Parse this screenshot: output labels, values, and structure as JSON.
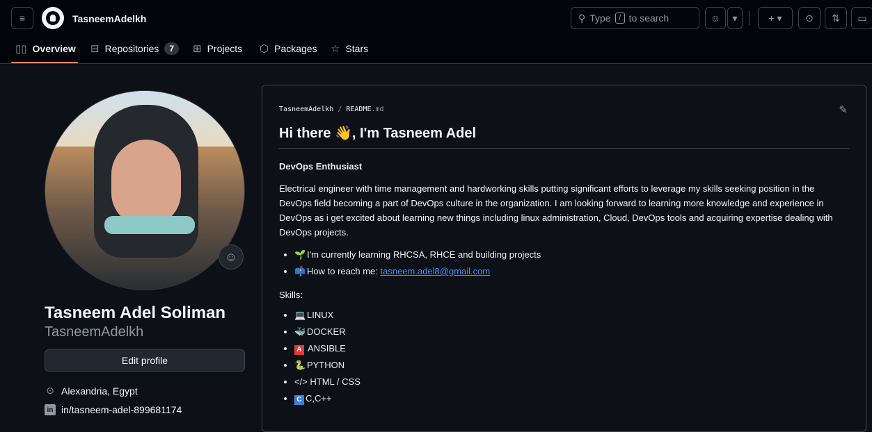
{
  "header": {
    "username": "TasneemAdelkh",
    "search_prefix": "Type",
    "search_key": "/",
    "search_suffix": "to search"
  },
  "tabs": [
    {
      "label": "Overview",
      "icon": "book-icon"
    },
    {
      "label": "Repositories",
      "icon": "repo-icon",
      "count": "7"
    },
    {
      "label": "Projects",
      "icon": "table-icon"
    },
    {
      "label": "Packages",
      "icon": "package-icon"
    },
    {
      "label": "Stars",
      "icon": "star-icon"
    }
  ],
  "profile": {
    "full_name": "Tasneem Adel Soliman",
    "login": "TasneemAdelkh",
    "edit_label": "Edit profile",
    "location": "Alexandria, Egypt",
    "linkedin": "in/tasneem-adel-899681174"
  },
  "readme": {
    "owner": "TasneemAdelkh",
    "separator": "/",
    "file_base": "README",
    "file_ext": ".md",
    "title": "Hi there 👋, I'm Tasneem Adel",
    "subtitle": "DevOps Enthusiast",
    "bio": "Electrical engineer with time management and hardworking skills putting significant efforts to leverage my skills seeking position in the DevOps field becoming a part of DevOps culture in the organization. I am looking forward to learning more knowledge and experience in DevOps as i get excited about learning new things including linux administration, Cloud, DevOps tools and acquiring expertise dealing with DevOps projects.",
    "learning": "I'm currently learning RHCSA, RHCE and building projects",
    "reach_prefix": "How to reach me:",
    "email": "tasneem.adel8@gmail.com",
    "skills_label": "Skills:",
    "skills": [
      "LINUX",
      "DOCKER",
      "ANSIBLE",
      "PYTHON",
      "</> HTML / CSS",
      "C,C++"
    ]
  },
  "colors": {
    "accent": "#f78166",
    "link": "#4493f8",
    "background": "#0d1117"
  }
}
